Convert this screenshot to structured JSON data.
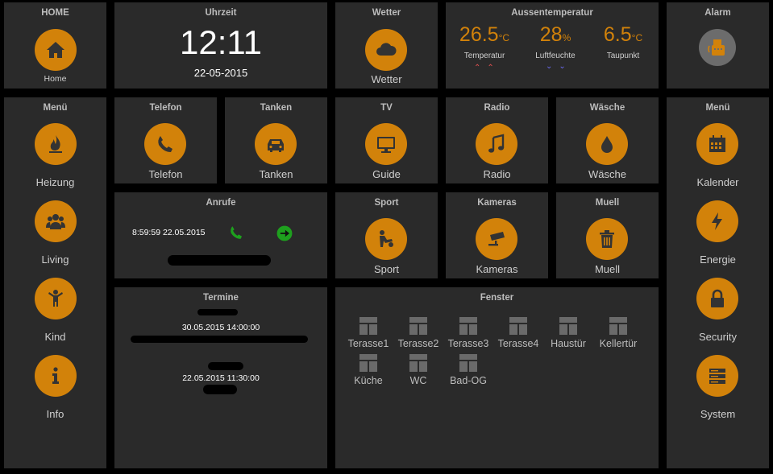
{
  "home": {
    "title": "HOME",
    "label": "Home"
  },
  "clock": {
    "title": "Uhrzeit",
    "time": "12:11",
    "date": "22-05-2015"
  },
  "weather": {
    "title": "Wetter",
    "label": "Wetter"
  },
  "outside": {
    "title": "Aussentemperatur",
    "temp_value": "26.5",
    "temp_unit": "°C",
    "temp_label": "Temperatur",
    "hum_value": "28",
    "hum_unit": "%",
    "hum_label": "Luftfeuchte",
    "dew_value": "6.5",
    "dew_unit": "°C",
    "dew_label": "Taupunkt",
    "trend_up": "⌃⌃",
    "trend_down": "⌄⌄"
  },
  "alarm": {
    "title": "Alarm"
  },
  "left_menu": {
    "title": "Menü",
    "items": [
      {
        "label": "Heizung",
        "icon": "flame-icon"
      },
      {
        "label": "Living",
        "icon": "people-icon"
      },
      {
        "label": "Kind",
        "icon": "child-icon"
      },
      {
        "label": "Info",
        "icon": "info-icon"
      }
    ]
  },
  "phone": {
    "title": "Telefon",
    "label": "Telefon"
  },
  "fuel": {
    "title": "Tanken",
    "label": "Tanken"
  },
  "tv": {
    "title": "TV",
    "label": "Guide"
  },
  "radio": {
    "title": "Radio",
    "label": "Radio"
  },
  "laundry": {
    "title": "Wäsche",
    "label": "Wäsche"
  },
  "right_menu": {
    "title": "Menü",
    "items": [
      {
        "label": "Kalender",
        "icon": "calendar-icon"
      },
      {
        "label": "Energie",
        "icon": "lightning-icon"
      },
      {
        "label": "Security",
        "icon": "lock-icon"
      },
      {
        "label": "System",
        "icon": "server-icon"
      }
    ]
  },
  "calls": {
    "title": "Anrufe",
    "entry_time": "8:59:59 22.05.2015"
  },
  "sport": {
    "title": "Sport",
    "label": "Sport"
  },
  "cameras": {
    "title": "Kameras",
    "label": "Kameras"
  },
  "trash": {
    "title": "Muell",
    "label": "Muell"
  },
  "appointments": {
    "title": "Termine",
    "entries": [
      {
        "datetime": "30.05.2015   14:00:00"
      },
      {
        "datetime": "22.05.2015   11:30:00"
      }
    ]
  },
  "windows": {
    "title": "Fenster",
    "items": [
      "Terasse1",
      "Terasse2",
      "Terasse3",
      "Terasse4",
      "Haustür",
      "Kellertür",
      "Küche",
      "WC",
      "Bad-OG"
    ]
  },
  "colors": {
    "accent": "#d2820a",
    "tile": "#2a2a2a",
    "background": "#000000"
  }
}
